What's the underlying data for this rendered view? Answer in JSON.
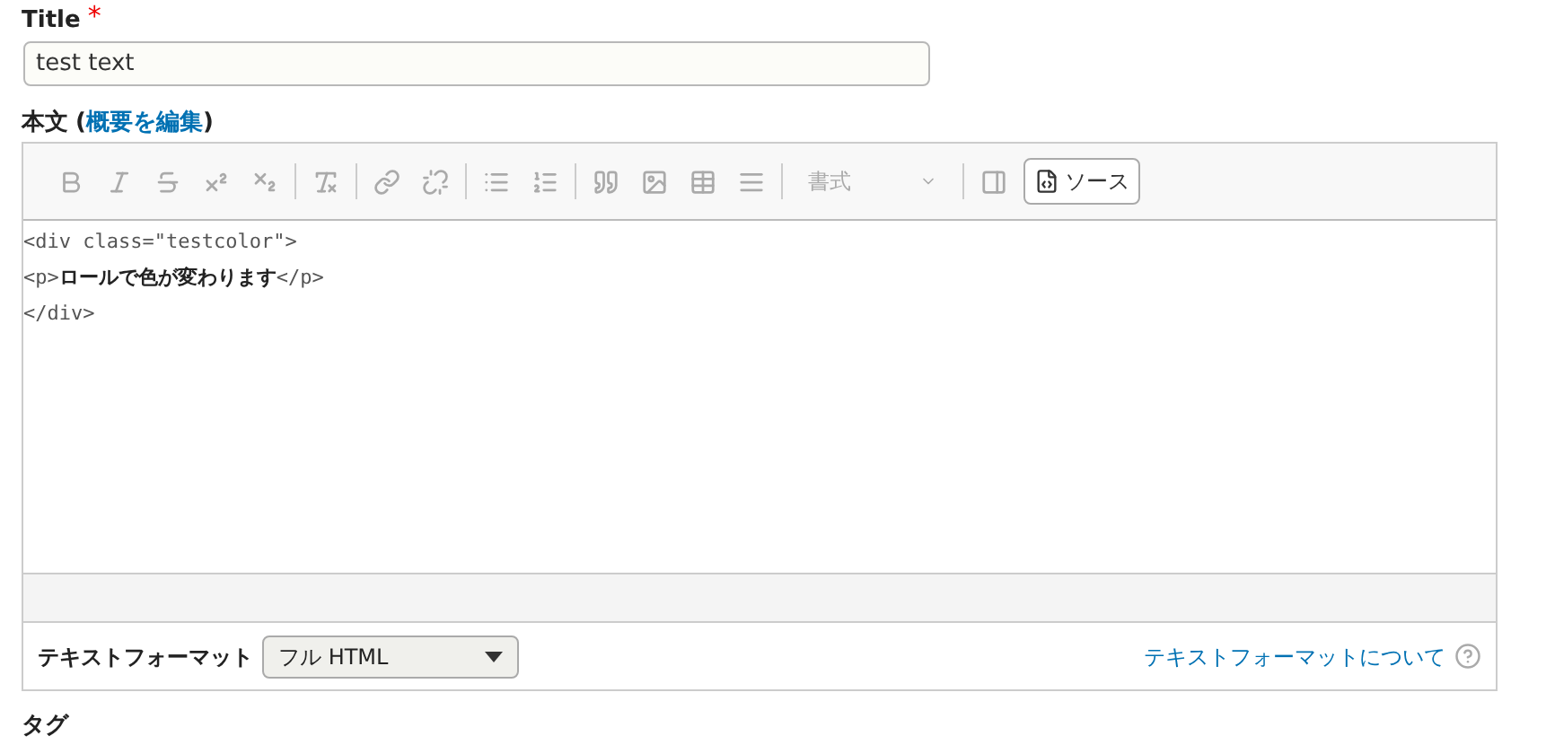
{
  "title_field": {
    "label": "Title",
    "required_mark": "*",
    "value": "test text"
  },
  "body": {
    "label": "本文",
    "summary_open": "(",
    "summary_link": "概要を編集",
    "summary_close": ")",
    "toolbar": [
      {
        "kind": "icon",
        "disabled": true
      },
      {
        "kind": "icon",
        "disabled": true
      },
      {
        "kind": "icon",
        "disabled": true
      },
      {
        "kind": "icon",
        "disabled": true
      },
      {
        "kind": "icon",
        "disabled": true
      },
      {
        "kind": "separator"
      },
      {
        "kind": "icon",
        "disabled": true
      },
      {
        "kind": "separator"
      },
      {
        "kind": "icon",
        "disabled": true
      },
      {
        "kind": "icon",
        "disabled": true
      },
      {
        "kind": "separator"
      },
      {
        "kind": "icon",
        "disabled": true
      },
      {
        "kind": "icon",
        "disabled": true
      },
      {
        "kind": "separator"
      },
      {
        "kind": "icon",
        "disabled": true
      },
      {
        "kind": "icon",
        "disabled": true
      },
      {
        "kind": "icon",
        "disabled": true
      },
      {
        "kind": "icon",
        "disabled": true
      },
      {
        "kind": "separator"
      },
      {
        "kind": "dropdown",
        "label": "書式",
        "disabled": true
      },
      {
        "kind": "separator"
      },
      {
        "kind": "icon",
        "disabled": true
      },
      {
        "kind": "source",
        "label": "ソース",
        "disabled": false
      }
    ],
    "code_lines": [
      "<div class=\"testcolor\">",
      "<p>**ロールで色が変わります**</p>",
      "</div>"
    ],
    "format_label": "テキストフォーマット",
    "format_value": "フル HTML",
    "format_help_link": "テキストフォーマットについて"
  },
  "tags_label": "タグ"
}
